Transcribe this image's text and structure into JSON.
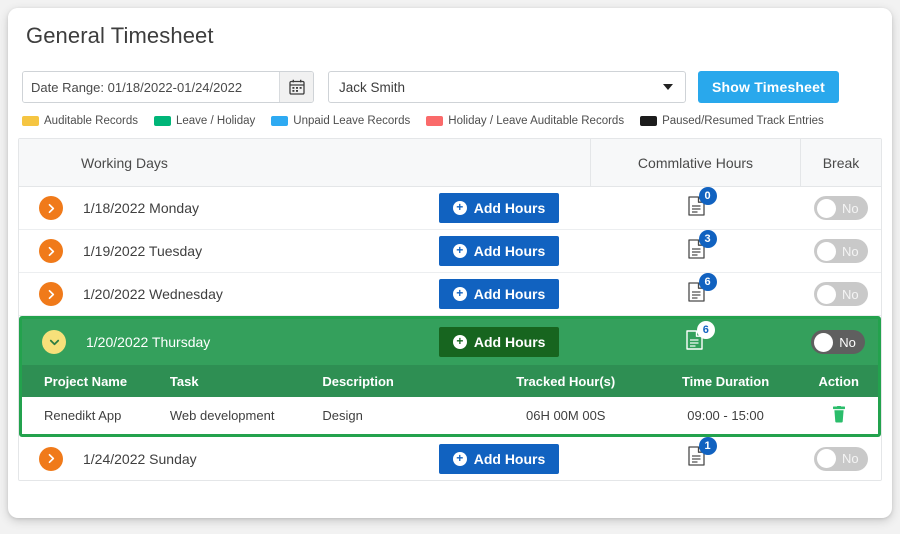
{
  "header": {
    "title": "General Timesheet"
  },
  "controls": {
    "date_range_value": "Date Range: 01/18/2022-01/24/2022",
    "date_range_placeholder": "Date Range",
    "calendar_icon": "calendar-icon",
    "person_value": "Jack Smith",
    "dropdown_icon": "chevron-down-icon",
    "show_timesheet_label": "Show Timesheet",
    "accent_blue": "#29a8ec"
  },
  "legend": [
    {
      "label": "Auditable Records",
      "color": "#f5c542"
    },
    {
      "label": "Leave / Holiday",
      "color": "#00b578"
    },
    {
      "label": "Unpaid Leave Records",
      "color": "#2eaaf2"
    },
    {
      "label": "Holiday / Leave Auditable Records",
      "color": "#fa6a6a"
    },
    {
      "label": "Paused/Resumed Track Entries",
      "color": "#1c1c1c"
    }
  ],
  "table": {
    "columns": [
      "Working Days",
      "Commlative Hours",
      "Break"
    ],
    "add_hours_label": "Add Hours",
    "toggle_off_label": "No",
    "doc_icon": "document-icon",
    "rows": [
      {
        "day": "1/18/2022 Monday",
        "count": "0",
        "break": "No",
        "expanded": false,
        "expander_icon": "chevron-right-icon"
      },
      {
        "day": "1/19/2022 Tuesday",
        "count": "3",
        "break": "No",
        "expanded": false,
        "expander_icon": "chevron-right-icon"
      },
      {
        "day": "1/20/2022 Wednesday",
        "count": "6",
        "break": "No",
        "expanded": false,
        "expander_icon": "chevron-right-icon"
      },
      {
        "day": "1/20/2022 Thursday",
        "count": "6",
        "break": "No",
        "expanded": true,
        "expander_icon": "chevron-down-icon"
      },
      {
        "day": "1/24/2022 Sunday",
        "count": "1",
        "break": "No",
        "expanded": false,
        "expander_icon": "chevron-right-icon"
      }
    ]
  },
  "detail": {
    "columns": [
      "Project Name",
      "Task",
      "Description",
      "Tracked Hour(s)",
      "Time Duration",
      "Action"
    ],
    "entries": [
      {
        "project": "Renedikt App",
        "task": "Web development",
        "description": "Design",
        "tracked": "06H 00M 00S",
        "duration": "09:00 - 15:00",
        "action_icon": "trash-icon"
      }
    ],
    "accent_green": "#34a05c",
    "header_green": "#2e8f53",
    "border_green": "#23a24d",
    "trash_color": "#2bbd6b"
  }
}
